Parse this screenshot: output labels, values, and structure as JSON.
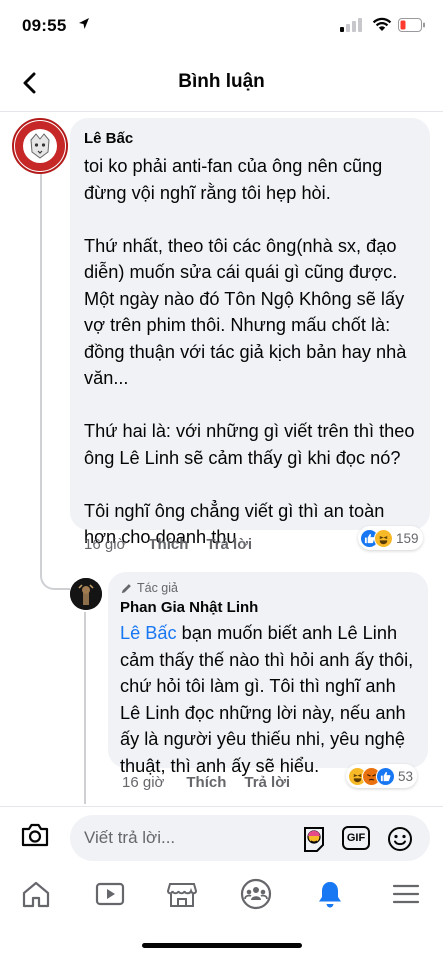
{
  "status_bar": {
    "time": "09:55"
  },
  "header": {
    "title": "Bình luận"
  },
  "comments": [
    {
      "author": "Lê Bấc",
      "text": "toi ko phải anti-fan của ông nên cũng đừng vội nghĩ rằng tôi hẹp hòi.\n\nThứ nhất, theo tôi các ông(nhà sx, đạo diễn) muốn sửa cái quái gì cũng được. Một ngày nào đó Tôn Ngộ Không sẽ lấy vợ trên phim thôi. Nhưng mấu chốt là: đồng thuận với tác giả kịch bản hay nhà văn...\n\nThứ hai là: với những gì viết trên thì theo ông Lê Linh sẽ cảm thấy gì khi đọc nó?\n\nTôi nghĩ ông chẳng viết gì thì an toàn hơn cho doanh thu",
      "time": "16 giờ",
      "like_label": "Thích",
      "reply_label": "Trả lời",
      "reaction_count": "159",
      "reaction_icons": [
        "like",
        "haha"
      ]
    },
    {
      "author_badge": "Tác giả",
      "author": "Phan Gia Nhật Linh",
      "mention": "Lê Bấc",
      "text": " bạn muốn biết anh Lê Linh cảm thấy thế nào thì hỏi anh ấy thôi, chứ hỏi tôi làm gì. Tôi thì nghĩ anh Lê Linh đọc những lời này, nếu anh ấy là người yêu thiếu nhi, yêu nghệ thuật, thì anh ấy sẽ hiểu.",
      "time": "16 giờ",
      "like_label": "Thích",
      "reply_label": "Trả lời",
      "reaction_count": "53",
      "reaction_icons": [
        "haha",
        "angry",
        "like"
      ]
    }
  ],
  "reply_bar": {
    "placeholder": "Viết trả lời...",
    "gif_label": "GIF"
  },
  "colors": {
    "accent": "#1877f2",
    "bubble": "#f0f2f5",
    "secondary_text": "#65676b"
  },
  "nav": [
    "home-icon",
    "watch-icon",
    "marketplace-icon",
    "groups-icon",
    "notifications-icon",
    "menu-icon"
  ]
}
